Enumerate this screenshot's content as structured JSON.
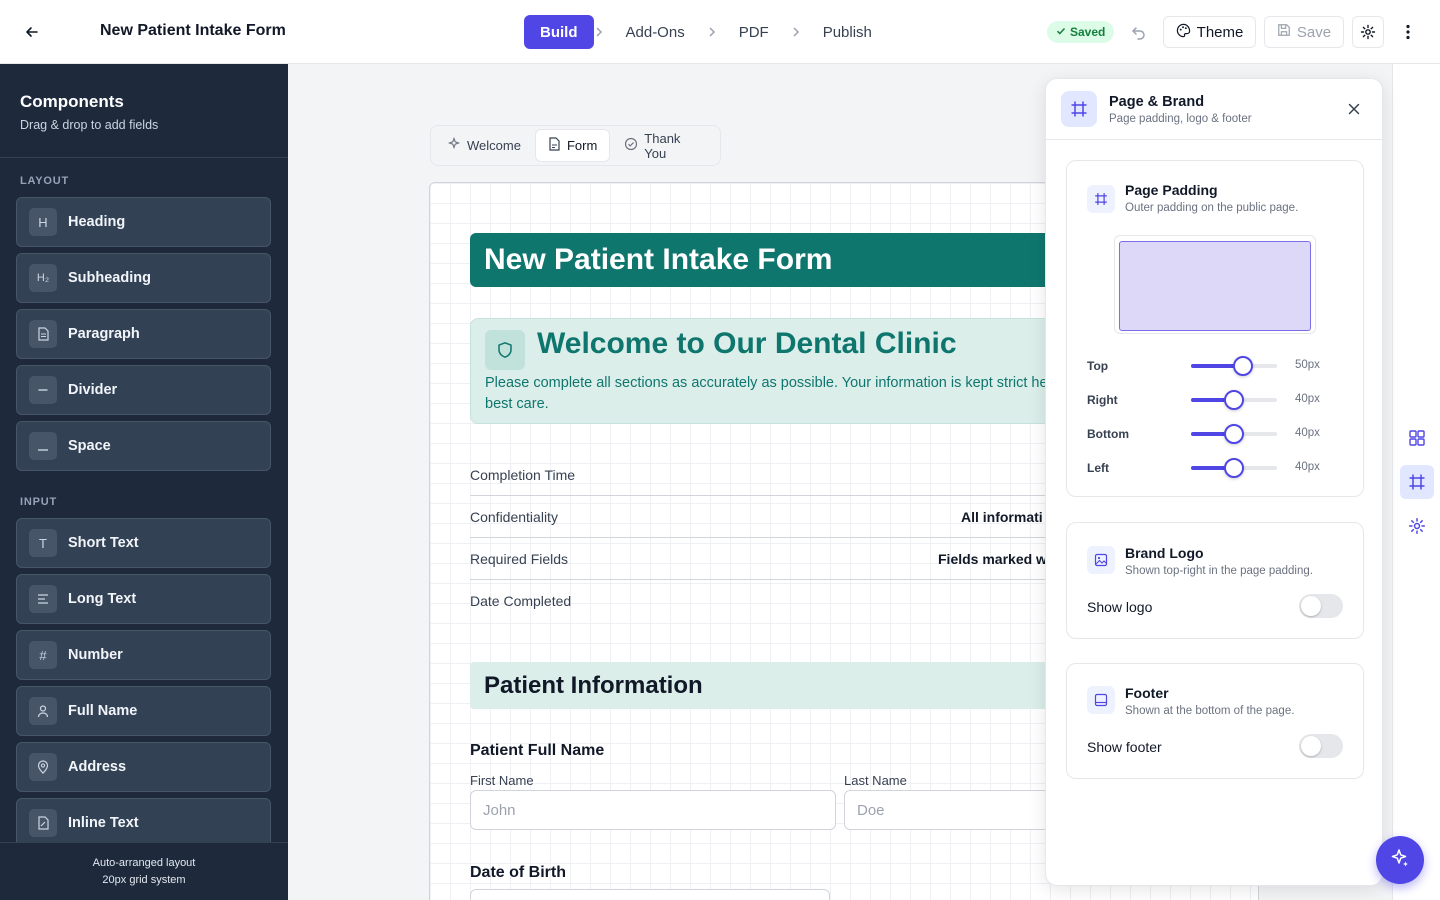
{
  "header": {
    "title": "New Patient Intake Form",
    "steps": [
      "Build",
      "Add-Ons",
      "PDF",
      "Publish"
    ],
    "active_step": "Build",
    "saved_label": "Saved",
    "theme_label": "Theme",
    "save_label": "Save"
  },
  "sidebar": {
    "title": "Components",
    "subtitle": "Drag & drop to add fields",
    "layout_heading": "LAYOUT",
    "layout_items": [
      {
        "label": "Heading",
        "icon": "heading-icon",
        "glyph": "H"
      },
      {
        "label": "Subheading",
        "icon": "subheading-icon",
        "glyph": "H₂"
      },
      {
        "label": "Paragraph",
        "icon": "paragraph-icon",
        "glyph": ""
      },
      {
        "label": "Divider",
        "icon": "divider-icon",
        "glyph": ""
      },
      {
        "label": "Space",
        "icon": "space-icon",
        "glyph": ""
      }
    ],
    "input_heading": "INPUT",
    "input_items": [
      {
        "label": "Short Text",
        "icon": "short-text-icon",
        "glyph": "T"
      },
      {
        "label": "Long Text",
        "icon": "long-text-icon",
        "glyph": ""
      },
      {
        "label": "Number",
        "icon": "number-icon",
        "glyph": "#"
      },
      {
        "label": "Full Name",
        "icon": "person-icon",
        "glyph": ""
      },
      {
        "label": "Address",
        "icon": "location-icon",
        "glyph": ""
      },
      {
        "label": "Inline Text",
        "icon": "inline-text-icon",
        "glyph": ""
      }
    ],
    "footer_line1": "Auto-arranged layout",
    "footer_line2": "20px grid system"
  },
  "canvas": {
    "tabs": [
      "Welcome",
      "Form",
      "Thank You"
    ],
    "active_tab": "Form",
    "banner_title": "New Patient Intake Form",
    "welcome_title": "Welcome to Our Dental Clinic",
    "welcome_text": "Please complete all sections as accurately as possible. Your information is kept strict helps us provide you with the best care.",
    "info_rows": [
      {
        "label": "Completion Time",
        "value": ""
      },
      {
        "label": "Confidentiality",
        "value": "All informati"
      },
      {
        "label": "Required Fields",
        "value": "Fields marked w"
      },
      {
        "label": "Date Completed",
        "value": ""
      }
    ],
    "section_title": "Patient Information",
    "full_name_title": "Patient Full Name",
    "first_name_label": "First Name",
    "first_name_placeholder": "John",
    "last_name_label": "Last Name",
    "last_name_placeholder": "Doe",
    "dob_title": "Date of Birth"
  },
  "panel": {
    "title": "Page & Brand",
    "subtitle": "Page padding, logo & footer",
    "padding": {
      "title": "Page Padding",
      "subtitle": "Outer padding on the public page.",
      "rows": [
        {
          "label": "Top",
          "value": "50px",
          "fraction": 0.6
        },
        {
          "label": "Right",
          "value": "40px",
          "fraction": 0.5
        },
        {
          "label": "Bottom",
          "value": "40px",
          "fraction": 0.5
        },
        {
          "label": "Left",
          "value": "40px",
          "fraction": 0.5
        }
      ]
    },
    "logo": {
      "title": "Brand Logo",
      "subtitle": "Shown top-right in the page padding.",
      "toggle_label": "Show logo",
      "enabled": false
    },
    "footer": {
      "title": "Footer",
      "subtitle": "Shown at the bottom of the page.",
      "toggle_label": "Show footer",
      "enabled": false
    }
  },
  "colors": {
    "accent": "#4f46e5",
    "brand_teal": "#0f766e",
    "sidebar_bg": "#1e293b",
    "saved_green": "#15803d"
  }
}
